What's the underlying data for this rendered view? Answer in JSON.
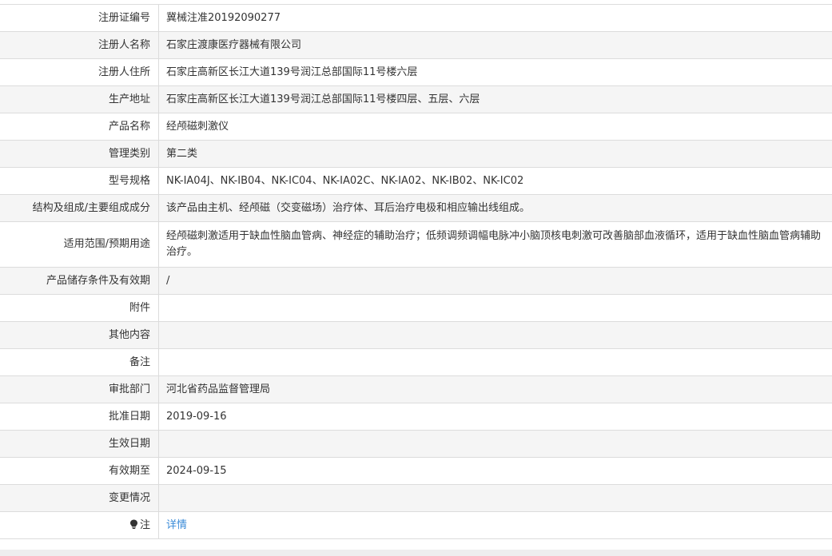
{
  "rows": [
    {
      "label": "注册证编号",
      "value": "冀械注准20192090277"
    },
    {
      "label": "注册人名称",
      "value": "石家庄渡康医疗器械有限公司"
    },
    {
      "label": "注册人住所",
      "value": "石家庄高新区长江大道139号润江总部国际11号楼六层"
    },
    {
      "label": "生产地址",
      "value": "石家庄高新区长江大道139号润江总部国际11号楼四层、五层、六层"
    },
    {
      "label": "产品名称",
      "value": "经颅磁刺激仪"
    },
    {
      "label": "管理类别",
      "value": "第二类"
    },
    {
      "label": "型号规格",
      "value": "NK-IA04J、NK-IB04、NK-IC04、NK-IA02C、NK-IA02、NK-IB02、NK-IC02"
    },
    {
      "label": "结构及组成/主要组成成分",
      "value": "该产品由主机、经颅磁（交变磁场）治疗体、耳后治疗电极和相应输出线组成。"
    },
    {
      "label": "适用范围/预期用途",
      "value": "经颅磁刺激适用于缺血性脑血管病、神经症的辅助治疗；低频调频调幅电脉冲小脑顶核电刺激可改善脑部血液循环，适用于缺血性脑血管病辅助治疗。"
    },
    {
      "label": "产品储存条件及有效期",
      "value": "/"
    },
    {
      "label": "附件",
      "value": ""
    },
    {
      "label": "其他内容",
      "value": ""
    },
    {
      "label": "备注",
      "value": ""
    },
    {
      "label": "审批部门",
      "value": "河北省药品监督管理局"
    },
    {
      "label": "批准日期",
      "value": "2019-09-16"
    },
    {
      "label": "生效日期",
      "value": ""
    },
    {
      "label": "有效期至",
      "value": "2024-09-15"
    },
    {
      "label": "变更情况",
      "value": ""
    }
  ],
  "note": {
    "label": "注",
    "icon": "lightbulb-icon",
    "link_text": "详情",
    "link_color": "#3a8bd8"
  }
}
